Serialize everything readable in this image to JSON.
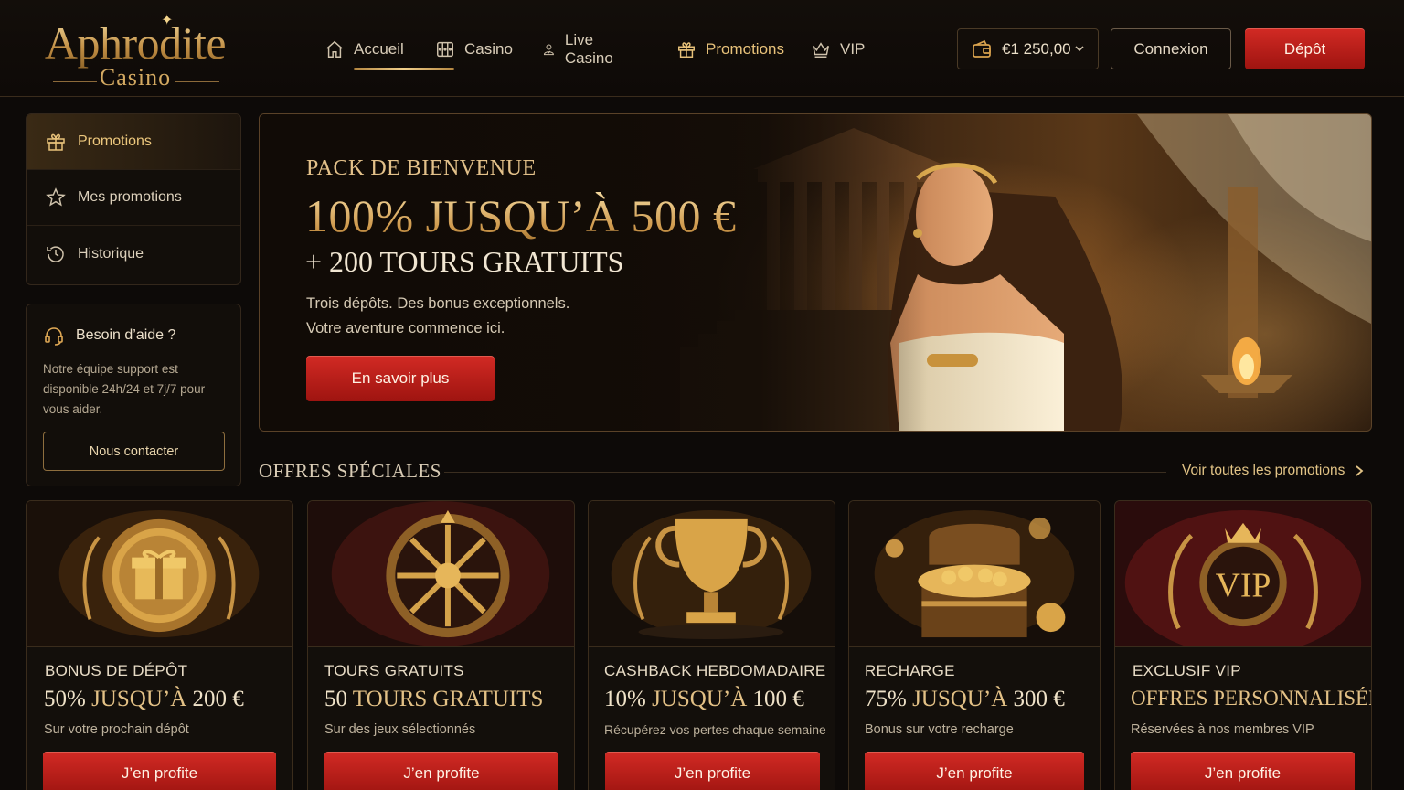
{
  "brand": {
    "name": "Aphrodite",
    "subtitle": "Casino"
  },
  "nav": [
    {
      "label": "Accueil",
      "icon": "home-icon"
    },
    {
      "label": "Casino",
      "icon": "slot-machine-icon"
    },
    {
      "label": "Live Casino",
      "icon": "dealer-icon"
    },
    {
      "label": "Promotions",
      "icon": "gift-icon",
      "active": true
    },
    {
      "label": "VIP",
      "icon": "crown-icon"
    }
  ],
  "wallet": {
    "balance": "€1 250,00",
    "icon": "wallet-icon"
  },
  "header": {
    "login_label": "Connexion",
    "deposit_label": "Dépôt"
  },
  "sidebar": {
    "items": [
      {
        "label": "Promotions",
        "icon": "gift-icon",
        "active": true
      },
      {
        "label": "Mes promotions",
        "icon": "star-icon"
      },
      {
        "label": "Historique",
        "icon": "history-icon"
      }
    ],
    "help": {
      "title": "Besoin d’aide ?",
      "text": "Notre équipe support est disponible 24h/24 et 7j/7 pour vous aider.",
      "button": "Nous contacter",
      "icon": "headset-icon"
    }
  },
  "hero": {
    "eyebrow": "PACK DE BIENVENUE",
    "title": "100% JUSQU’À 500 €",
    "subtitle": "+ 200 TOURS GRATUITS",
    "text_line1": "Trois dépôts. Des bonus exceptionnels.",
    "text_line2": "Votre aventure commence ici.",
    "button": "En savoir plus"
  },
  "offers": {
    "title": "OFFRES SPÉCIALES",
    "see_all": "Voir toutes les promotions",
    "cards": [
      {
        "label": "BONUS DE DÉPÔT",
        "offer_big": "50%",
        "offer_rest": " JUSQU’À ",
        "offer_end": "200 €",
        "desc": "Sur votre prochain dépôt",
        "button": "J’en profite",
        "icon": "gift-medallion-icon"
      },
      {
        "label": "TOURS GRATUITS",
        "offer_big": "50",
        "offer_rest": " TOURS GRATUITS",
        "offer_end": "",
        "desc": "Sur des jeux sélectionnés",
        "button": "J’en profite",
        "icon": "wheel-icon"
      },
      {
        "label": "CASHBACK HEBDOMADAIRE",
        "offer_big": "10%",
        "offer_rest": " JUSQU’À ",
        "offer_end": "100 €",
        "desc": "Récupérez vos pertes chaque semaine",
        "button": "J’en profite",
        "icon": "trophy-icon"
      },
      {
        "label": "RECHARGE",
        "offer_big": "75%",
        "offer_rest": " JUSQU’À ",
        "offer_end": "300 €",
        "desc": "Bonus sur votre recharge",
        "button": "J’en profite",
        "icon": "treasure-chest-icon"
      },
      {
        "label": "EXCLUSIF VIP",
        "offer_big": "",
        "offer_rest": "OFFRES PERSONNALISÉES",
        "offer_end": "",
        "desc": "Réservées à nos membres VIP",
        "button": "J’en profite",
        "icon": "vip-crest-icon"
      }
    ]
  },
  "colors": {
    "gold": "#e2b56a",
    "red": "#c41f1a",
    "background": "#0d0a08"
  }
}
